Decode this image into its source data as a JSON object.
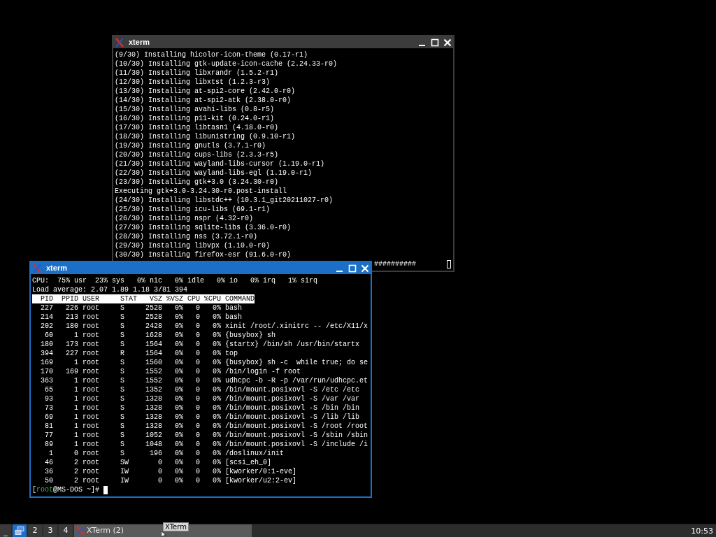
{
  "windows": [
    {
      "title": "xterm",
      "active": false,
      "kind": "log",
      "lines": [
        "(9/30) Installing hicolor-icon-theme (0.17-r1)",
        "(10/30) Installing gtk-update-icon-cache (2.24.33-r0)",
        "(11/30) Installing libxrandr (1.5.2-r1)",
        "(12/30) Installing libxtst (1.2.3-r3)",
        "(13/30) Installing at-spi2-core (2.42.0-r0)",
        "(14/30) Installing at-spi2-atk (2.38.0-r0)",
        "(15/30) Installing avahi-libs (0.8-r5)",
        "(16/30) Installing p11-kit (0.24.0-r1)",
        "(17/30) Installing libtasn1 (4.18.0-r0)",
        "(18/30) Installing libunistring (0.9.10-r1)",
        "(19/30) Installing gnutls (3.7.1-r0)",
        "(20/30) Installing cups-libs (2.3.3-r5)",
        "(21/30) Installing wayland-libs-cursor (1.19.0-r1)",
        "(22/30) Installing wayland-libs-egl (1.19.0-r1)",
        "(23/30) Installing gtk+3.0 (3.24.30-r0)",
        "Executing gtk+3.0-3.24.30-r0.post-install",
        "(24/30) Installing libstdc++ (10.3.1_git20211027-r0)",
        "(25/30) Installing icu-libs (69.1-r1)",
        "(26/30) Installing nspr (4.32-r0)",
        "(27/30) Installing sqlite-libs (3.36.0-r0)",
        "(28/30) Installing nss (3.72.1-r0)",
        "(29/30) Installing libvpx (1.10.0-r0)",
        "(30/30) Installing firefox-esr (91.6.0-r0)"
      ],
      "progress_tail": "##########"
    },
    {
      "title": "xterm",
      "active": true,
      "kind": "top",
      "cpu_line": "CPU:  75% usr  23% sys   0% nic   0% idle   0% io   0% irq   1% sirq",
      "load_line": "Load average: 2.07 1.89 1.18 3/81 394",
      "columns": [
        "PID",
        "PPID",
        "USER",
        "STAT",
        "VSZ",
        "%VSZ",
        "CPU",
        "%CPU",
        "COMMAND"
      ],
      "rows": [
        [
          "227",
          "226",
          "root",
          "S",
          "2528",
          "0%",
          "0",
          "0%",
          "bash"
        ],
        [
          "214",
          "213",
          "root",
          "S",
          "2528",
          "0%",
          "0",
          "0%",
          "bash"
        ],
        [
          "202",
          "180",
          "root",
          "S",
          "2428",
          "0%",
          "0",
          "0%",
          "xinit /root/.xinitrc -- /etc/X11/x"
        ],
        [
          "60",
          "1",
          "root",
          "S",
          "1628",
          "0%",
          "0",
          "0%",
          "{busybox} sh"
        ],
        [
          "180",
          "173",
          "root",
          "S",
          "1564",
          "0%",
          "0",
          "0%",
          "{startx} /bin/sh /usr/bin/startx"
        ],
        [
          "394",
          "227",
          "root",
          "R",
          "1564",
          "0%",
          "0",
          "0%",
          "top"
        ],
        [
          "169",
          "1",
          "root",
          "S",
          "1560",
          "0%",
          "0",
          "0%",
          "{busybox} sh -c  while true; do se"
        ],
        [
          "170",
          "169",
          "root",
          "S",
          "1552",
          "0%",
          "0",
          "0%",
          "/bin/login -f root"
        ],
        [
          "363",
          "1",
          "root",
          "S",
          "1552",
          "0%",
          "0",
          "0%",
          "udhcpc -b -R -p /var/run/udhcpc.et"
        ],
        [
          "65",
          "1",
          "root",
          "S",
          "1352",
          "0%",
          "0",
          "0%",
          "/bin/mount.posixovl -S /etc /etc"
        ],
        [
          "93",
          "1",
          "root",
          "S",
          "1328",
          "0%",
          "0",
          "0%",
          "/bin/mount.posixovl -S /var /var"
        ],
        [
          "73",
          "1",
          "root",
          "S",
          "1328",
          "0%",
          "0",
          "0%",
          "/bin/mount.posixovl -S /bin /bin"
        ],
        [
          "69",
          "1",
          "root",
          "S",
          "1328",
          "0%",
          "0",
          "0%",
          "/bin/mount.posixovl -S /lib /lib"
        ],
        [
          "81",
          "1",
          "root",
          "S",
          "1328",
          "0%",
          "0",
          "0%",
          "/bin/mount.posixovl -S /root /root"
        ],
        [
          "77",
          "1",
          "root",
          "S",
          "1052",
          "0%",
          "0",
          "0%",
          "/bin/mount.posixovl -S /sbin /sbin"
        ],
        [
          "89",
          "1",
          "root",
          "S",
          "1048",
          "0%",
          "0",
          "0%",
          "/bin/mount.posixovl -S /include /i"
        ],
        [
          "1",
          "0",
          "root",
          "S",
          "196",
          "0%",
          "0",
          "0%",
          "/doslinux/init"
        ],
        [
          "46",
          "2",
          "root",
          "SW",
          "0",
          "0%",
          "0",
          "0%",
          "[scsi_eh_0]"
        ],
        [
          "36",
          "2",
          "root",
          "IW",
          "0",
          "0%",
          "0",
          "0%",
          "[kworker/0:1-eve]"
        ],
        [
          "50",
          "2",
          "root",
          "IW",
          "0",
          "0%",
          "0",
          "0%",
          "[kworker/u2:2-ev]"
        ]
      ],
      "prompt": {
        "open": "[",
        "user": "root",
        "rest": "@MS-DOS ~]# "
      }
    }
  ],
  "taskbar": {
    "show_desktop": "_",
    "workspaces": [
      {
        "kind": "icon",
        "selected": true
      },
      {
        "label": "2",
        "selected": false
      },
      {
        "label": "3",
        "selected": false
      },
      {
        "label": "4",
        "selected": false
      }
    ],
    "tasks": [
      {
        "label": "XTerm (2)"
      }
    ],
    "tooltip": "XTerm",
    "clock": "10:53"
  }
}
